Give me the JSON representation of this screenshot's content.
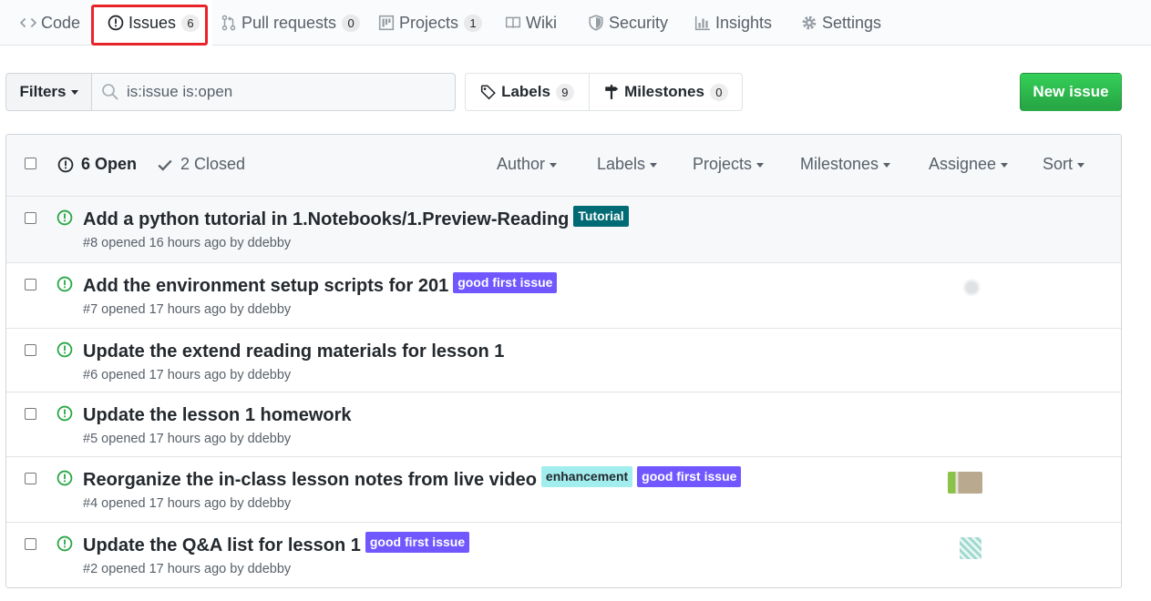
{
  "reponav": {
    "tabs": [
      {
        "label": "Code",
        "icon": "code-icon"
      },
      {
        "label": "Issues",
        "icon": "issue-opened-icon",
        "count": "6",
        "selected": true
      },
      {
        "label": "Pull requests",
        "icon": "git-pull-request-icon",
        "count": "0"
      },
      {
        "label": "Projects",
        "icon": "project-icon",
        "count": "1"
      },
      {
        "label": "Wiki",
        "icon": "book-icon"
      },
      {
        "label": "Security",
        "icon": "shield-icon"
      },
      {
        "label": "Insights",
        "icon": "graph-icon"
      },
      {
        "label": "Settings",
        "icon": "gear-icon"
      }
    ]
  },
  "subnav": {
    "filters_label": "Filters",
    "search_value": "is:issue is:open",
    "labels_label": "Labels",
    "labels_count": "9",
    "milestones_label": "Milestones",
    "milestones_count": "0",
    "new_issue_label": "New issue"
  },
  "issues_header": {
    "open_label": "6 Open",
    "closed_label": "2 Closed",
    "filters": [
      "Author",
      "Labels",
      "Projects",
      "Milestones",
      "Assignee",
      "Sort"
    ]
  },
  "issues": [
    {
      "title": "Add a python tutorial in 1.Notebooks/1.Preview-Reading",
      "meta": "#8 opened 16 hours ago by ddebby",
      "labels": [
        {
          "name": "Tutorial",
          "bg": "#006b75",
          "fg": "#ffffff"
        }
      ],
      "has_assignee": false
    },
    {
      "title": "Add the environment setup scripts for 201",
      "meta": "#7 opened 17 hours ago by ddebby",
      "labels": [
        {
          "name": "good first issue",
          "bg": "#7057ff",
          "fg": "#ffffff"
        }
      ],
      "has_assignee": true
    },
    {
      "title": "Update the extend reading materials for lesson 1",
      "meta": "#6 opened 17 hours ago by ddebby",
      "labels": [],
      "has_assignee": false
    },
    {
      "title": "Update the lesson 1 homework",
      "meta": "#5 opened 17 hours ago by ddebby",
      "labels": [],
      "has_assignee": false
    },
    {
      "title": "Reorganize the in-class lesson notes from live video",
      "meta": "#4 opened 17 hours ago by ddebby",
      "labels": [
        {
          "name": "enhancement",
          "bg": "#a2eeef",
          "fg": "#24292e"
        },
        {
          "name": "good first issue",
          "bg": "#7057ff",
          "fg": "#ffffff"
        }
      ],
      "has_assignee": true
    },
    {
      "title": "Update the Q&A list for lesson 1",
      "meta": "#2 opened 17 hours ago by ddebby",
      "labels": [
        {
          "name": "good first issue",
          "bg": "#7057ff",
          "fg": "#ffffff"
        }
      ],
      "has_assignee": true
    }
  ],
  "colors": {
    "open_green": "#28a745",
    "highlight": "#e8242b",
    "accent_orange": "#e36209"
  }
}
